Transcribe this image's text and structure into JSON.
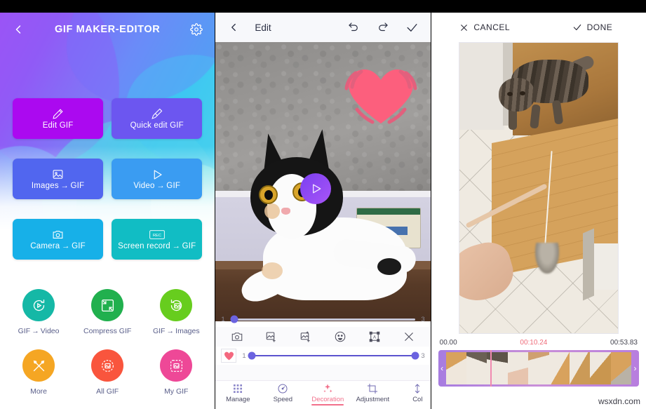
{
  "panel1": {
    "header": {
      "title": "GIF MAKER-EDITOR",
      "back_icon": "chevron-left-icon",
      "settings_icon": "gear-icon"
    },
    "grid_buttons": [
      {
        "label": "Edit GIF",
        "icon": "pencil-icon",
        "color": "#ab09f0"
      },
      {
        "label": "Quick edit GIF",
        "icon": "brush-icon",
        "color": "#6c56f0"
      },
      {
        "label": "Images → GIF",
        "icon": "image-icon",
        "color": "#5166ef"
      },
      {
        "label": "Video → GIF",
        "icon": "play-icon",
        "color": "#3a9cf2"
      },
      {
        "label": "Camera → GIF",
        "icon": "camera-icon",
        "color": "#17b0e8"
      },
      {
        "label": "Screen record → GIF",
        "icon": "rec-icon",
        "color": "#11bdc4"
      }
    ],
    "circle_buttons": [
      {
        "label": "GIF → Video",
        "icon": "gif-to-video-icon",
        "color": "#15b8a6"
      },
      {
        "label": "Compress GIF",
        "icon": "compress-icon",
        "color": "#21b04e"
      },
      {
        "label": "GIF → Images",
        "icon": "gif-to-images-icon",
        "color": "#67cd1e"
      },
      {
        "label": "More",
        "icon": "tools-icon",
        "color": "#f5a623"
      },
      {
        "label": "All GIF",
        "icon": "all-gif-icon",
        "color": "#f9553d"
      },
      {
        "label": "My GIF",
        "icon": "my-gif-icon",
        "color": "#ee4897"
      }
    ]
  },
  "panel2": {
    "header": {
      "title": "Edit",
      "back_icon": "chevron-left-icon",
      "undo_icon": "undo-icon",
      "redo_icon": "redo-icon",
      "confirm_icon": "check-icon"
    },
    "canvas": {
      "sticker": "heart-sticker",
      "play_overlay_icon": "play-icon"
    },
    "frame_slider": {
      "min_label": "1",
      "max_label": "3",
      "value": 1
    },
    "tools": [
      {
        "icon": "camera-icon"
      },
      {
        "icon": "add-image-icon"
      },
      {
        "icon": "add-frame-icon"
      },
      {
        "icon": "emoji-icon"
      },
      {
        "icon": "text-box-icon"
      },
      {
        "icon": "close-icon"
      }
    ],
    "sticker_range": {
      "thumb_icon": "heart-sticker-thumb",
      "start_label": "1",
      "end_label": "3",
      "start_value": 1,
      "end_value": 3
    },
    "nav_tabs": [
      {
        "label": "Manage",
        "icon": "grid-icon",
        "active": false
      },
      {
        "label": "Speed",
        "icon": "speedometer-icon",
        "active": false
      },
      {
        "label": "Decoration",
        "icon": "sparkle-icon",
        "active": true
      },
      {
        "label": "Adjustment",
        "icon": "crop-icon",
        "active": false
      },
      {
        "label": "Col",
        "icon": "sliders-icon",
        "active": false
      }
    ]
  },
  "panel3": {
    "header": {
      "cancel_label": "CANCEL",
      "cancel_icon": "close-icon",
      "done_label": "DONE",
      "done_icon": "check-icon"
    },
    "timeline": {
      "start_time": "00.00",
      "current_time": "00:10.24",
      "end_time": "00:53.83",
      "frame_count": 9,
      "trim_handle_left": "‹",
      "trim_handle_right": "›"
    },
    "watermark": "wsxdn.com"
  },
  "colors": {
    "accent_pink": "#f2708b",
    "slider_purple": "#6b63e0",
    "current_time_red": "#ef6c7a",
    "filmstrip_border": "#b77ede"
  }
}
